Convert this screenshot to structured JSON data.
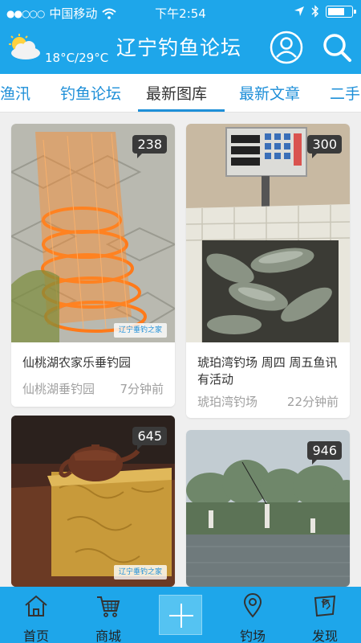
{
  "status": {
    "carrier": "中国移动",
    "time": "下午2:54"
  },
  "header": {
    "temperature": "18°C/29°C",
    "title": "辽宁钓鱼论坛"
  },
  "tabs": [
    {
      "label": "渔汛",
      "active": false
    },
    {
      "label": "钓鱼论坛",
      "active": false
    },
    {
      "label": "最新图库",
      "active": true
    },
    {
      "label": "最新文章",
      "active": false
    },
    {
      "label": "二手",
      "active": false
    }
  ],
  "cards": [
    {
      "count": "238",
      "title": "仙桃湖农家乐垂钓园",
      "author": "仙桃湖垂钓园",
      "time": "7分钟前",
      "watermark": "辽宁垂钓之家"
    },
    {
      "count": "300",
      "title": "琥珀湾钓场 周四 周五鱼讯有活动",
      "author": "琥珀湾钓场",
      "time": "22分钟前"
    },
    {
      "count": "645",
      "watermark": "辽宁垂钓之家"
    },
    {
      "count": "946"
    }
  ],
  "bottom_nav": [
    {
      "label": "首页",
      "icon": "home-icon"
    },
    {
      "label": "商城",
      "icon": "cart-icon"
    },
    {
      "label": "",
      "icon": "plus-icon"
    },
    {
      "label": "钓场",
      "icon": "location-icon"
    },
    {
      "label": "发现",
      "icon": "flag-map-icon"
    }
  ],
  "colors": {
    "primary": "#1ea6ea",
    "tab_active_underline": "#1e8fd8",
    "tab_text": "#1e8fd8"
  }
}
